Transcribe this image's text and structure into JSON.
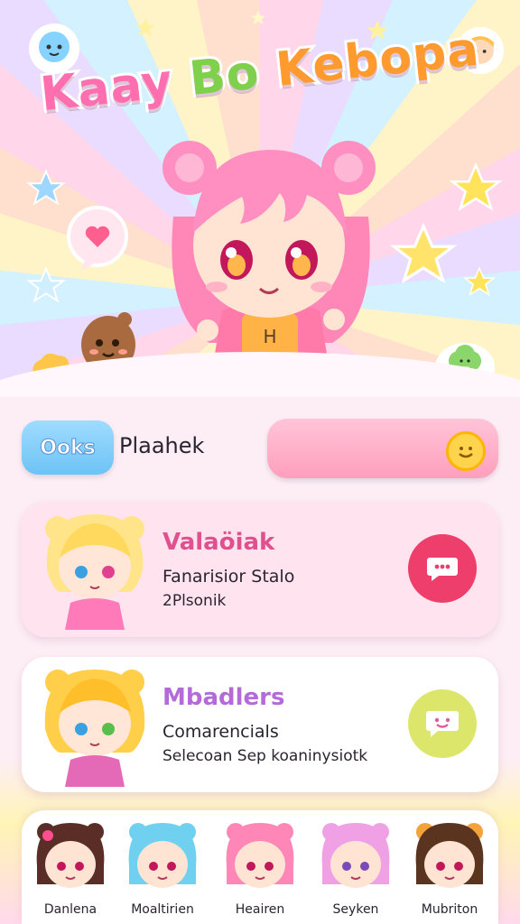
{
  "header": {
    "title_parts": [
      "Kaay",
      "Bo",
      "Kebopa"
    ],
    "title_colors": [
      "#ff6fb0",
      "#7fd04a",
      "#ff9a2f"
    ]
  },
  "search_row": {
    "button_label": "Ooks",
    "label": "Plaahek"
  },
  "cards": [
    {
      "title": "Valaöiak",
      "title_color": "#e0508f",
      "line1": "Fanarisior Stalo",
      "line2": "2Plsonik",
      "action_icon": "chat-bubble-icon",
      "action_color": "#ee3e6b"
    },
    {
      "title": "Mbadlers",
      "title_color": "#b46ad8",
      "line1": "Comarencials",
      "line2": "Selecoan Sep koaninysiotk",
      "action_icon": "heart-chat-icon",
      "action_color": "#dbe66a"
    }
  ],
  "bottom_nav": [
    {
      "label": "Danlena",
      "hair": "#5a2d27"
    },
    {
      "label": "Moaltirien",
      "hair": "#6fd0f0"
    },
    {
      "label": "Heairen",
      "hair": "#ff87b8"
    },
    {
      "label": "Seyken",
      "hair": "#f0a0e4"
    },
    {
      "label": "Mubriton",
      "hair": "#5b3420"
    }
  ]
}
